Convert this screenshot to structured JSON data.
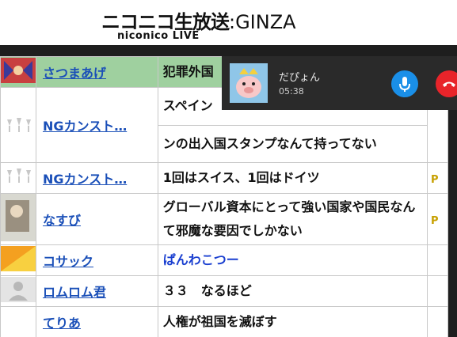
{
  "header": {
    "logo_main": "ニコニコ生放送",
    "logo_suffix": ":GINZA",
    "logo_sub": "niconico LIVE"
  },
  "call": {
    "name": "だぴょん",
    "time": "05:38",
    "mic_icon": "mic-icon",
    "hangup_icon": "phone-hangup-icon"
  },
  "comments": [
    {
      "user": "さつまあげ",
      "text": "犯罪外国"
    },
    {
      "user": "",
      "text": "スペイン"
    },
    {
      "user": "NGカンスト…",
      "text": "ンの出入国スタンプなんて持ってない"
    },
    {
      "user": "NGカンスト…",
      "text": "1回はスイス、1回はドイツ",
      "mark": "P"
    },
    {
      "user": "なすび",
      "text": "グローバル資本にとって強い国家や国民なんて邪魔な要因でしかない",
      "mark": "P"
    },
    {
      "user": "コサック",
      "text": "ぱんわこつー"
    },
    {
      "user": "ロムロム君",
      "text": "３３　なるほど"
    },
    {
      "user": "てりあ",
      "text": "人権が祖国を滅ぼす"
    }
  ],
  "colors": {
    "accent_green": "#9fd09f",
    "link_blue": "#1a4fb8",
    "mic_blue": "#1a8fe8",
    "hangup_red": "#e8242a"
  }
}
